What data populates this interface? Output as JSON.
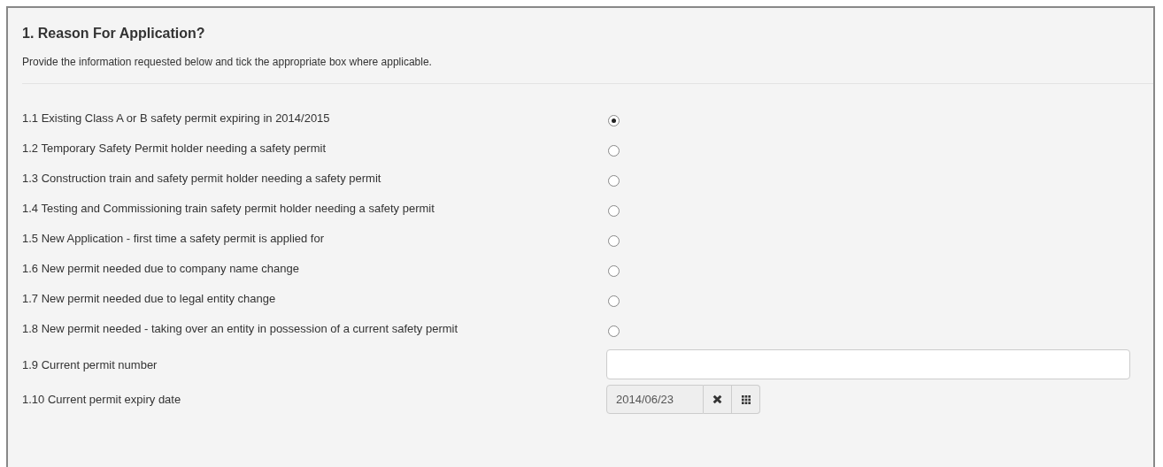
{
  "section": {
    "title": "1. Reason For Application?",
    "instructions": "Provide the information requested below and tick the appropriate box where applicable."
  },
  "options": [
    {
      "label": "1.1 Existing Class A or B safety permit expiring in 2014/2015",
      "selected": true
    },
    {
      "label": "1.2 Temporary Safety Permit holder needing a safety permit",
      "selected": false
    },
    {
      "label": "1.3 Construction train and safety permit holder needing a safety permit",
      "selected": false
    },
    {
      "label": "1.4 Testing and Commissioning train safety permit holder needing a safety permit",
      "selected": false
    },
    {
      "label": "1.5 New Application - first time a safety permit is applied for",
      "selected": false
    },
    {
      "label": "1.6 New permit needed due to company name change",
      "selected": false
    },
    {
      "label": "1.7 New permit needed due to legal entity change",
      "selected": false
    },
    {
      "label": "1.8 New permit needed - taking over an entity in possession of a current safety permit",
      "selected": false
    }
  ],
  "fields": [
    {
      "kind": "text",
      "label": "1.9 Current permit number"
    },
    {
      "kind": "date",
      "label": "1.10 Current permit expiry date",
      "value": "2014/06/23"
    }
  ]
}
